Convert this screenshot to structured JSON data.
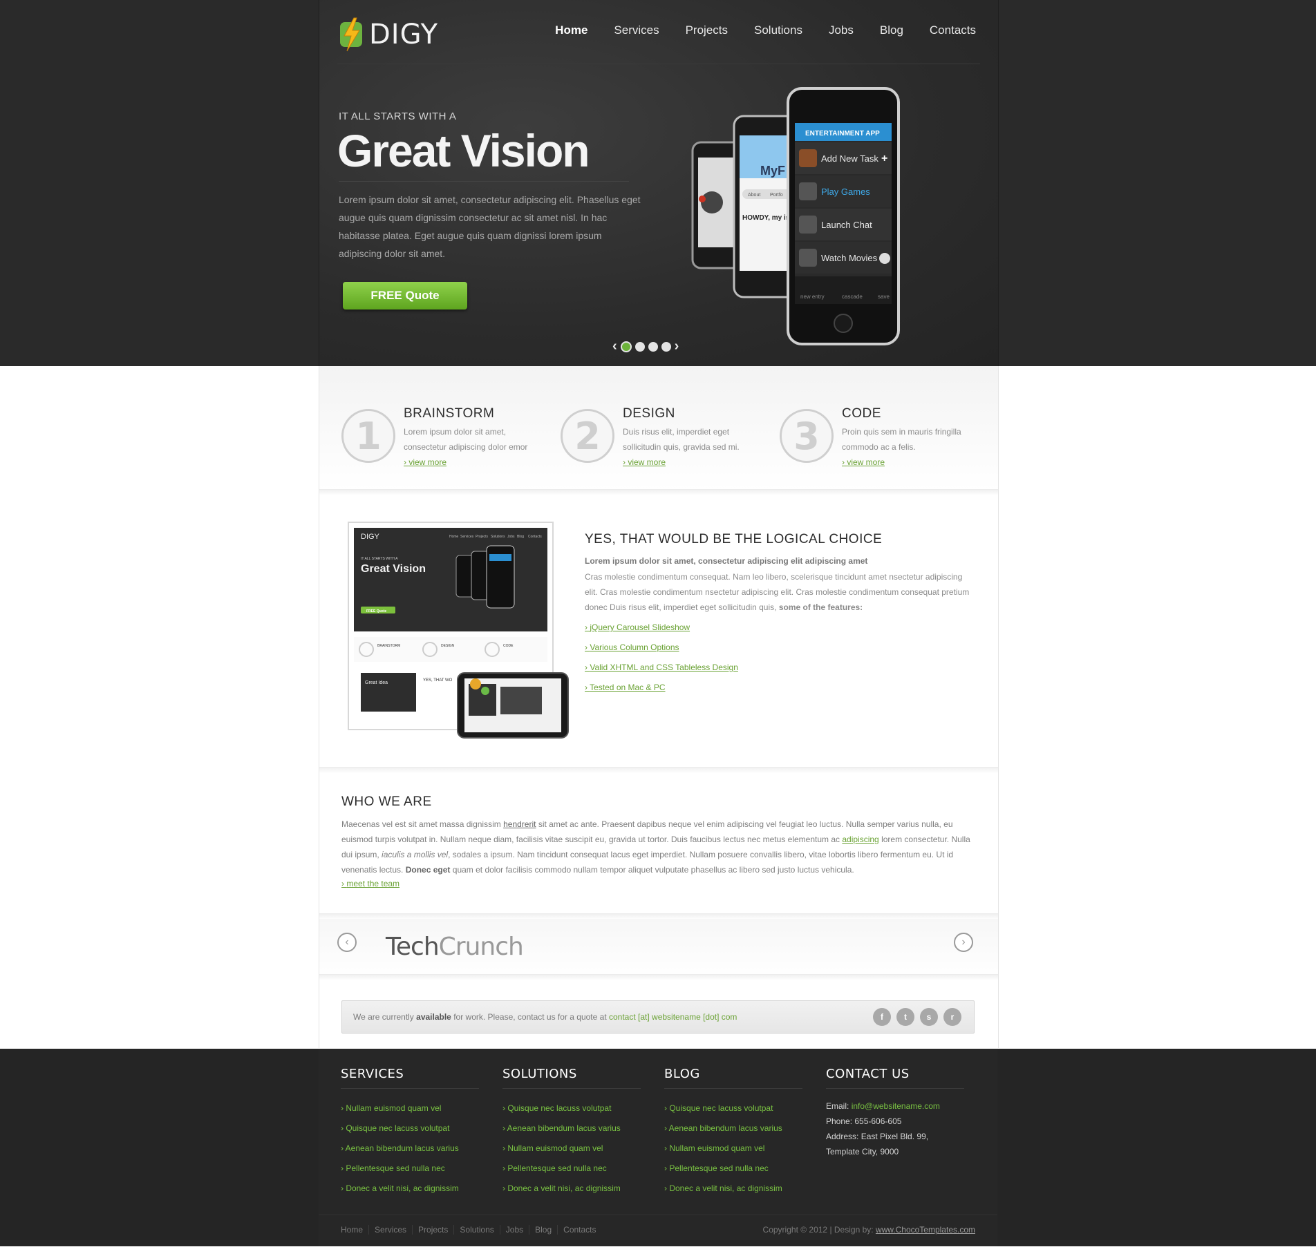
{
  "brand": {
    "name": "DIGY"
  },
  "nav": {
    "items": [
      {
        "label": "Home",
        "active": true
      },
      {
        "label": "Services"
      },
      {
        "label": "Projects"
      },
      {
        "label": "Solutions"
      },
      {
        "label": "Jobs"
      },
      {
        "label": "Blog"
      },
      {
        "label": "Contacts"
      }
    ]
  },
  "hero": {
    "kicker": "IT ALL STARTS WITH A",
    "title": "Great Vision",
    "text": "Lorem ipsum dolor sit amet, consectetur adipiscing elit. Phasellus eget augue quis quam dignissim consectetur ac sit amet nisl. In hac habitasse platea. Eget augue quis quam dignissi lorem ipsum adipiscing dolor sit amet.",
    "button": "FREE Quote",
    "slider_dots": 4,
    "slider_active": 1,
    "phone_app": {
      "header": "ENTERTAINMENT APP",
      "items": [
        "Add New Task",
        "Play Games",
        "Launch Chat",
        "Watch Movies"
      ],
      "toolbar": [
        "new entry",
        "cascade",
        "save"
      ]
    },
    "phone2": {
      "title": "MyF",
      "tabs": [
        "About",
        "Portfo"
      ],
      "greeting": "HOWDY, my is John Smi I'm Web Dev"
    }
  },
  "steps": [
    {
      "num": "1",
      "title": "BRAINSTORM",
      "text": "Lorem ipsum dolor sit amet, consectetur adipiscing dolor emor",
      "link": "view more"
    },
    {
      "num": "2",
      "title": "DESIGN",
      "text": "Duis risus elit, imperdiet eget sollicitudin quis, gravida sed mi.",
      "link": "view more"
    },
    {
      "num": "3",
      "title": "CODE",
      "text": "Proin quis sem in mauris fringilla commodo ac a felis.",
      "link": "view more"
    }
  ],
  "logical": {
    "title": "YES, THAT WOULD BE THE LOGICAL CHOICE",
    "lead": "Lorem ipsum dolor sit amet, consectetur adipiscing elit adipiscing amet",
    "text": "Cras molestie condimentum consequat. Nam leo libero, scelerisque tincidunt amet nsectetur adipiscing elit. Cras molestie condimentum nsectetur adipiscing elit. Cras molestie condimentum consequat pretium donec Duis risus elit, imperdiet eget sollicitudin quis,",
    "text_bold": "some of the features:",
    "features": [
      "jQuery Carousel Slideshow",
      "Various Column Options",
      "Valid XHTML and CSS Tableless Design",
      "Tested on Mac & PC"
    ],
    "thumb": {
      "brand": "DIGY",
      "nav": [
        "Home",
        "Services",
        "Projects",
        "Solutions",
        "Jobs",
        "Blog",
        "Contacts"
      ],
      "kicker": "IT ALL STARTS WITH A",
      "title": "Great Vision",
      "button": "FREE Quote",
      "steps": [
        "BRAINSTORM",
        "DESIGN",
        "CODE"
      ],
      "mini_title": "Great Idea",
      "mini_heading": "YES, THAT WO"
    }
  },
  "who": {
    "title": "WHO WE ARE",
    "p1": "Maecenas vel est sit amet massa dignissim",
    "link1": "hendrerit",
    "p2": "sit amet ac ante. Praesent dapibus neque vel enim adipiscing vel feugiat leo luctus. Nulla semper varius nulla, eu euismod turpis volutpat in. Nullam neque diam, facilisis vitae suscipit eu, gravida ut tortor. Duis faucibus lectus nec metus elementum ac",
    "link2": "adipiscing",
    "p3": "lorem consectetur. Nulla dui ipsum,",
    "italic": "iaculis a mollis vel",
    "p4": ", sodales a ipsum. Nam tincidunt consequat lacus eget imperdiet. Nullam posuere convallis libero, vitae lobortis libero fermentum eu. Ut id venenatis lectus.",
    "bold": "Donec eget",
    "p5": "quam et dolor facilisis commodo nullam tempor aliquet vulputate phasellus ac libero sed justo luctus vehicula.",
    "link": "meet the team"
  },
  "brand_carousel": {
    "logo_a": "Tech",
    "logo_b": "Crunch"
  },
  "availability": {
    "pre": "We are currently",
    "bold": "available",
    "mid": "for work. Please, contact us for a quote at",
    "email": "contact [at] websitename [dot] com",
    "social": [
      "facebook",
      "twitter",
      "skype",
      "rss"
    ]
  },
  "footer": {
    "columns": [
      {
        "title": "SERVICES",
        "items": [
          "Nullam euismod quam vel",
          "Quisque nec lacuss volutpat",
          "Aenean bibendum lacus varius",
          "Pellentesque sed nulla nec",
          "Donec a velit nisi, ac dignissim"
        ]
      },
      {
        "title": "SOLUTIONS",
        "items": [
          "Quisque nec lacuss volutpat",
          "Aenean bibendum lacus varius",
          "Nullam euismod quam vel",
          "Pellentesque sed nulla nec",
          "Donec a velit nisi, ac dignissim"
        ]
      },
      {
        "title": "BLOG",
        "items": [
          "Quisque nec lacuss volutpat",
          "Aenean bibendum lacus varius",
          "Nullam euismod quam vel",
          "Pellentesque sed nulla nec",
          "Donec a velit nisi, ac dignissim"
        ]
      }
    ],
    "contact": {
      "title": "CONTACT US",
      "email_label": "Email:",
      "email": "info@websitename.com",
      "phone": "Phone: 655-606-605",
      "address1": "Address: East Pixel Bld. 99,",
      "address2": "Template City, 9000"
    },
    "bottom_nav": [
      "Home",
      "Services",
      "Projects",
      "Solutions",
      "Jobs",
      "Blog",
      "Contacts"
    ],
    "copyright": "Copyright © 2012  |  Design by:",
    "designer": "www.ChocoTemplates.com"
  },
  "colors": {
    "accent": "#6aa234",
    "dark": "#2a2a2a",
    "footer_link": "#79c142"
  }
}
